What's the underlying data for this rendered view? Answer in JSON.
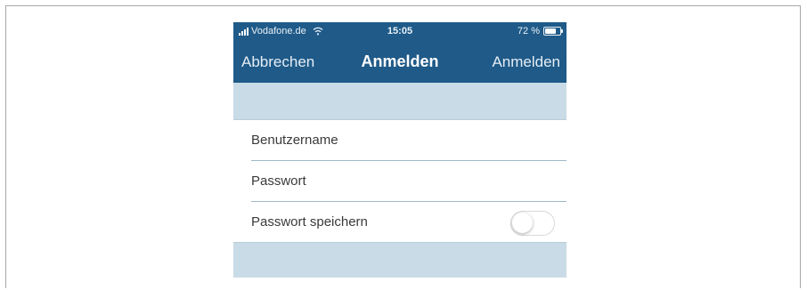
{
  "status_bar": {
    "carrier": "Vodafone.de",
    "time": "15:05",
    "battery_percent": "72 %",
    "battery_level": 0.72,
    "signal_icon": "signal-bars-icon",
    "wifi_icon": "wifi-icon",
    "battery_icon": "battery-icon"
  },
  "nav_bar": {
    "cancel_label": "Abbrechen",
    "title": "Anmelden",
    "login_label": "Anmelden"
  },
  "form": {
    "username_placeholder": "Benutzername",
    "password_placeholder": "Passwort",
    "save_password_label": "Passwort speichern",
    "save_password_on": false
  },
  "colors": {
    "nav_background": "#1f5a88",
    "section_background": "#c9dbe6",
    "divider": "#9fb9ca"
  }
}
